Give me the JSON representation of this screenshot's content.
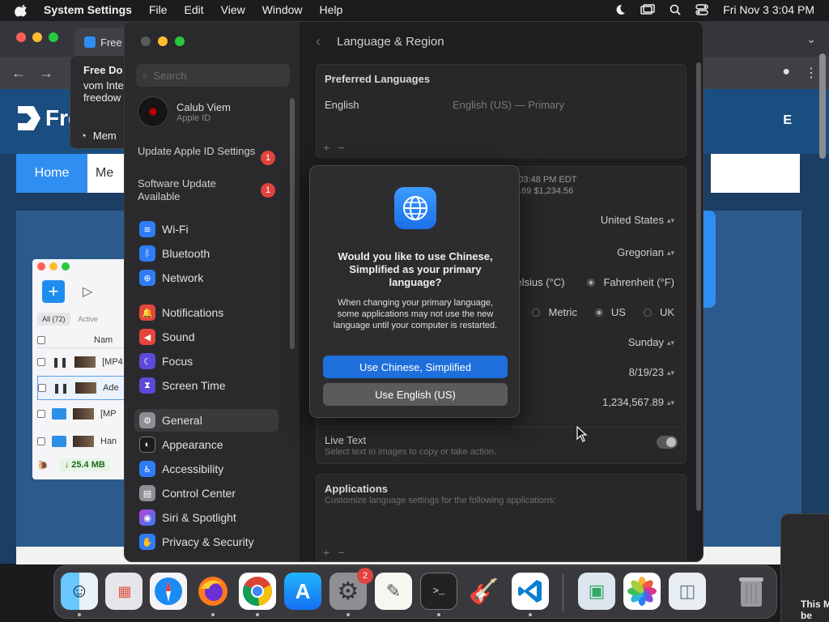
{
  "menubar": {
    "app": "System Settings",
    "items": [
      "File",
      "Edit",
      "View",
      "Window",
      "Help"
    ],
    "datetime": "Fri Nov 3  3:04 PM"
  },
  "browser": {
    "tab_title": "Free",
    "tooltip_lines": [
      "Free Do",
      "vom Inte",
      "freedow"
    ],
    "tooltip_mem": "Mem",
    "logo_text": "Fre",
    "header_right": "E",
    "nav_home": "Home",
    "nav_me": "Me"
  },
  "download_manager": {
    "tabs": [
      "All (72)",
      "Active"
    ],
    "col_name": "Nam",
    "rows": [
      "[MP4",
      "Ade",
      "[MP",
      "Han"
    ],
    "speed": "↓ 25.4 MB"
  },
  "settings": {
    "search_placeholder": "Search",
    "account": {
      "name": "Calub Viem",
      "sub": "Apple ID"
    },
    "alerts": [
      {
        "label": "Update Apple ID Settings",
        "badge": "1"
      },
      {
        "label": "Software Update Available",
        "badge": "1"
      }
    ],
    "sidebar": [
      {
        "label": "Wi-Fi",
        "icon": "wifi-icon",
        "color": "#2f7cf6"
      },
      {
        "label": "Bluetooth",
        "icon": "bluetooth-icon",
        "color": "#2f7cf6"
      },
      {
        "label": "Network",
        "icon": "globe-icon",
        "color": "#2f7cf6"
      },
      {
        "label": "Notifications",
        "icon": "bell-icon",
        "color": "#e4463d"
      },
      {
        "label": "Sound",
        "icon": "speaker-icon",
        "color": "#e4463d"
      },
      {
        "label": "Focus",
        "icon": "moon-icon",
        "color": "#5b4bd8"
      },
      {
        "label": "Screen Time",
        "icon": "hourglass-icon",
        "color": "#5b4bd8"
      },
      {
        "label": "General",
        "icon": "gear-icon",
        "color": "#8e8e93"
      },
      {
        "label": "Appearance",
        "icon": "appearance-icon",
        "color": "#1c1c1e"
      },
      {
        "label": "Accessibility",
        "icon": "accessibility-icon",
        "color": "#2f7cf6"
      },
      {
        "label": "Control Center",
        "icon": "control-center-icon",
        "color": "#8e8e93"
      },
      {
        "label": "Siri & Spotlight",
        "icon": "siri-icon",
        "color": "#c03fd6"
      },
      {
        "label": "Privacy & Security",
        "icon": "hand-icon",
        "color": "#2f7cf6"
      }
    ],
    "page_title": "Language & Region",
    "preferred_languages": {
      "title": "Preferred Languages",
      "language": "English",
      "detail": "English (US) — Primary"
    },
    "region_preview": {
      "time": "t 3:03:48 PM EDT",
      "numbers": ".89     $1,234.56"
    },
    "region": "United States",
    "calendar": "Gregorian",
    "temperature": {
      "celsius": "Celsius (°C)",
      "fahrenheit": "Fahrenheit (°F)"
    },
    "measurement": {
      "metric": "Metric",
      "us": "US",
      "uk": "UK"
    },
    "first_day": "Sunday",
    "date_format": "8/19/23",
    "number_format": "1,234,567.89",
    "live_text": {
      "title": "Live Text",
      "caption": "Select text in images to copy or take action."
    },
    "applications": {
      "title": "Applications",
      "caption": "Customize language settings for the following applications:"
    }
  },
  "dialog": {
    "title": "Would you like to use Chinese, Simplified as your primary language?",
    "message": "When changing your primary language, some applications may not use the new language until your computer is restarted.",
    "primary": "Use Chinese, Simplified",
    "secondary": "Use English (US)"
  },
  "dock": {
    "system_settings_badge": "2"
  },
  "notification": {
    "text": "This M be"
  }
}
